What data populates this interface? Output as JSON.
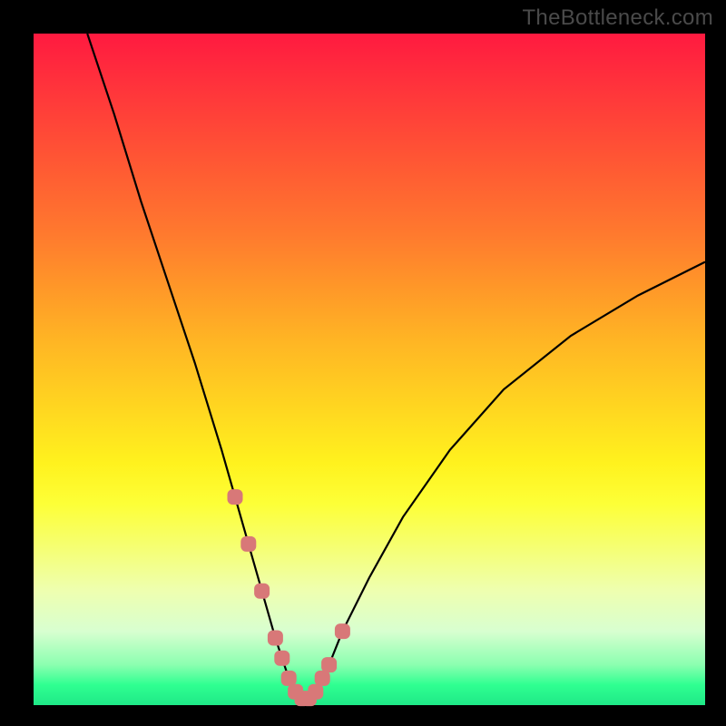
{
  "watermark": "TheBottleneck.com",
  "colors": {
    "frame": "#000000",
    "curve": "#000000",
    "marker": "#d87878",
    "gradient_top": "#ff1a40",
    "gradient_mid": "#fff21e",
    "gradient_bottom": "#1fe887"
  },
  "chart_data": {
    "type": "line",
    "title": "",
    "xlabel": "",
    "ylabel": "",
    "xlim": [
      0,
      100
    ],
    "ylim": [
      0,
      100
    ],
    "series": [
      {
        "name": "bottleneck-curve",
        "x": [
          8,
          12,
          16,
          20,
          24,
          28,
          30,
          32,
          34,
          36,
          37,
          38,
          39,
          40,
          41,
          42,
          43,
          44,
          46,
          50,
          55,
          62,
          70,
          80,
          90,
          100
        ],
        "values": [
          100,
          88,
          75,
          63,
          51,
          38,
          31,
          24,
          17,
          10,
          7,
          4,
          2,
          1,
          1,
          2,
          4,
          6,
          11,
          19,
          28,
          38,
          47,
          55,
          61,
          66
        ]
      }
    ],
    "markers": {
      "name": "highlighted-points",
      "x": [
        30,
        32,
        34,
        36,
        37,
        38,
        39,
        40,
        41,
        42,
        43,
        44,
        46
      ],
      "values": [
        31,
        24,
        17,
        10,
        7,
        4,
        2,
        1,
        1,
        2,
        4,
        6,
        11
      ]
    }
  }
}
